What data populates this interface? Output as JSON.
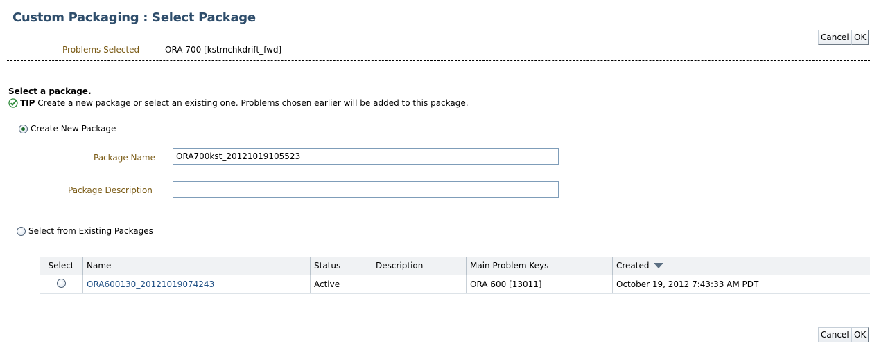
{
  "page_title": "Custom Packaging : Select Package",
  "buttons": {
    "cancel": "Cancel",
    "ok": "OK"
  },
  "problems_selected": {
    "label": "Problems Selected",
    "value": "ORA 700 [kstmchkdrift_fwd]"
  },
  "section": {
    "title": "Select a package.",
    "tip_label": "TIP",
    "tip_text": "Create a new package or select an existing one. Problems chosen earlier will be added to this package."
  },
  "create_new": {
    "label": "Create New Package",
    "selected": true,
    "package_name_label": "Package Name",
    "package_name_value": "ORA700kst_20121019105523",
    "package_description_label": "Package Description",
    "package_description_value": ""
  },
  "select_existing": {
    "label": "Select from Existing Packages",
    "selected": false
  },
  "table": {
    "columns": [
      "Select",
      "Name",
      "Status",
      "Description",
      "Main Problem Keys",
      "Created"
    ],
    "sorted_column": "Created",
    "sort_direction": "descending",
    "rows": [
      {
        "selected": false,
        "name": "ORA600130_20121019074243",
        "status": "Active",
        "description": "",
        "main_problem_keys": "ORA 600 [13011]",
        "created": "October 19, 2012 7:43:33 AM PDT"
      }
    ]
  },
  "colors": {
    "title": "#2e4d6b",
    "label": "#7a5a14",
    "link": "#1f4f84",
    "tip_check": "#2e8b3a"
  }
}
